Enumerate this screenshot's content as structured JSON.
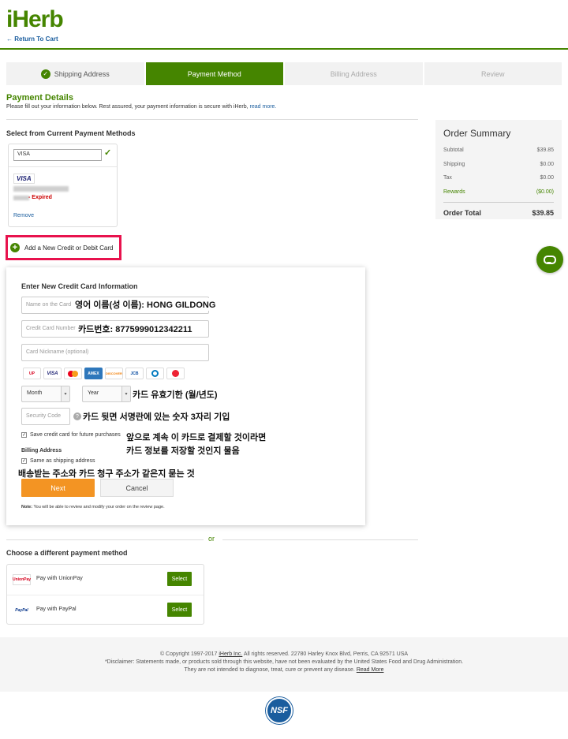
{
  "header": {
    "logo": "iHerb",
    "return_link": "← Return To Cart"
  },
  "steps": [
    {
      "label": "Shipping Address",
      "state": "done"
    },
    {
      "label": "Payment Method",
      "state": "active"
    },
    {
      "label": "Billing Address",
      "state": "pending"
    },
    {
      "label": "Review",
      "state": "pending"
    }
  ],
  "payment_details": {
    "title": "Payment Details",
    "subtitle": "Please fill out your information below. Rest assured, your payment information is secure with iHerb,",
    "read_more": "read more."
  },
  "current_methods": {
    "title": "Select from Current Payment Methods",
    "selected_card": "VISA",
    "card_brand": "VISA",
    "expired_label": "- Expired",
    "remove_label": "Remove"
  },
  "order_summary": {
    "title": "Order Summary",
    "rows": [
      {
        "label": "Subtotal",
        "value": "$39.85"
      },
      {
        "label": "Shipping",
        "value": "$0.00"
      },
      {
        "label": "Tax",
        "value": "$0.00"
      },
      {
        "label": "Rewards",
        "value": "($0.00)"
      }
    ],
    "total_label": "Order Total",
    "total_value": "$39.85"
  },
  "add_card": {
    "label": "Add a New Credit or Debit Card"
  },
  "form": {
    "title": "Enter New Credit Card Information",
    "name_placeholder": "Name on the Card",
    "number_placeholder": "Credit Card Number",
    "nickname_placeholder": "Card Nickname (optional)",
    "month_value": "Month",
    "year_value": "Year",
    "security_placeholder": "Security Code",
    "save_card_label": "Save credit card for future purchases",
    "billing_address_label": "Billing Address",
    "same_as_shipping_label": "Same as shipping address",
    "next_label": "Next",
    "cancel_label": "Cancel",
    "note_bold": "Note:",
    "note_text": " You will be able to review and modify your order on the review page.",
    "card_logos": [
      "UnionPay",
      "VISA",
      "MC",
      "AMEX",
      "DISCOVER",
      "JCB",
      "Diners",
      "Other"
    ]
  },
  "annotations": {
    "name": "영어 이름(성 이름): HONG GILDONG",
    "number": "카드번호: 8775999012342211",
    "expiry": "카드 유효기한 (월/년도)",
    "security": "카드 뒷면 서명란에 있는 숫자 3자리 기입",
    "save_line1": "앞으로 계속 이 카드로 결제할 것이라면",
    "save_line2": "카드 정보를 저장할 것인지 물음",
    "same_address": "배송받는 주소와 카드 청구 주소가 같은지 묻는 것"
  },
  "or_text": "or",
  "alternatives": {
    "title": "Choose a different payment method",
    "items": [
      {
        "logo": "UnionPay",
        "label": "Pay with UnionPay",
        "button": "Select"
      },
      {
        "logo": "PayPal",
        "label": "Pay with PayPal",
        "button": "Select"
      }
    ]
  },
  "footer": {
    "line1_pre": "© Copyright 1997-2017 ",
    "line1_link": "iHerb Inc.",
    "line1_post": " All rights reserved. 22780 Harley Knox Blvd, Perris, CA 92571 USA",
    "line2": "*Disclaimer: Statements made, or products sold through this website, have not been evaluated by the United States Food and Drug Administration.",
    "line3_pre": "They are not intended to diagnose, treat, cure or prevent any disease. ",
    "line3_link": "Read More",
    "nsf": "NSF"
  },
  "colors": {
    "brand_green": "#458500",
    "next_orange": "#f39423",
    "highlight_red": "#e8124d",
    "link_blue": "#1a5d9e"
  }
}
